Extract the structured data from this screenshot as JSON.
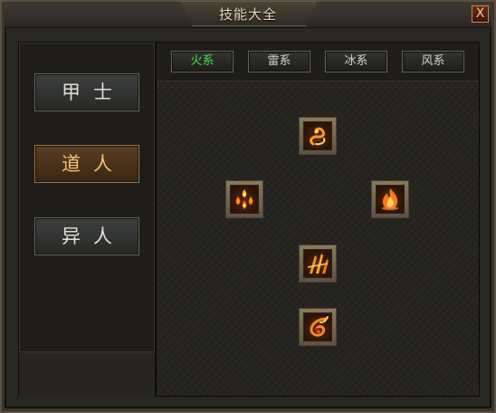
{
  "window": {
    "title": "技能大全",
    "close_label": "X"
  },
  "classes": [
    {
      "label": "甲士",
      "active": false
    },
    {
      "label": "道人",
      "active": true
    },
    {
      "label": "异人",
      "active": false
    }
  ],
  "tabs": [
    {
      "label": "火系",
      "active": true
    },
    {
      "label": "雷系",
      "active": false
    },
    {
      "label": "冰系",
      "active": false
    },
    {
      "label": "风系",
      "active": false
    }
  ],
  "skills": [
    {
      "icon": "fire-serpent-icon"
    },
    {
      "icon": "fire-orbs-icon"
    },
    {
      "icon": "fire-burst-icon"
    },
    {
      "icon": "fire-blades-icon"
    },
    {
      "icon": "fire-vortex-icon"
    }
  ],
  "colors": {
    "active_tab_text": "#3fe04a",
    "active_class_text": "#f6c070",
    "fire_orange": "#ff8a1a"
  }
}
